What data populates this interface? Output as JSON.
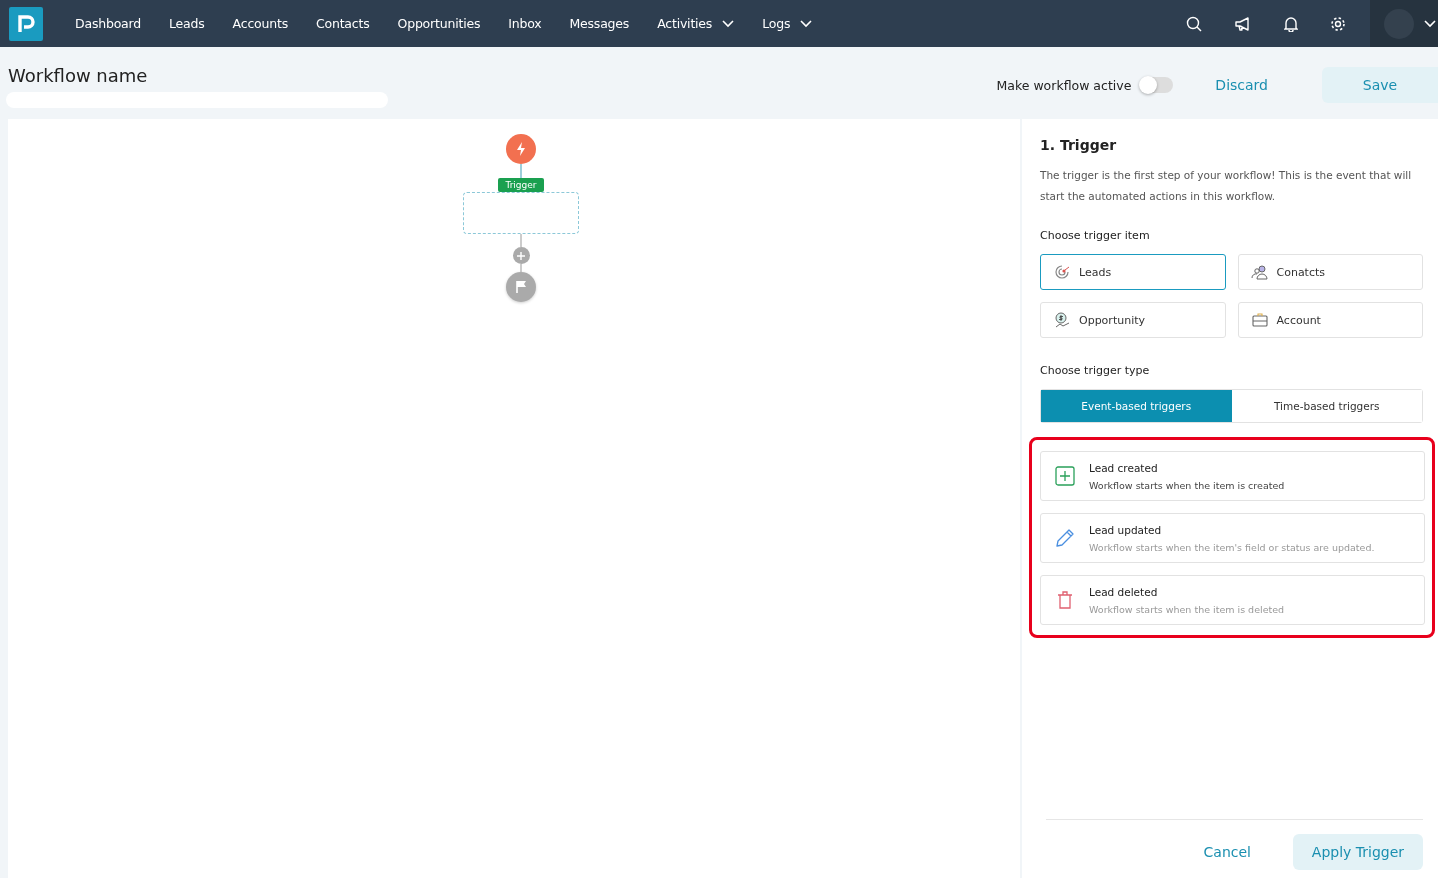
{
  "nav": {
    "items": [
      {
        "label": "Dashboard",
        "has_menu": false
      },
      {
        "label": "Leads",
        "has_menu": false
      },
      {
        "label": "Accounts",
        "has_menu": false
      },
      {
        "label": "Contacts",
        "has_menu": false
      },
      {
        "label": "Opportunities",
        "has_menu": false
      },
      {
        "label": "Inbox",
        "has_menu": false
      },
      {
        "label": "Messages",
        "has_menu": false
      },
      {
        "label": "Activities",
        "has_menu": true
      },
      {
        "label": "Logs",
        "has_menu": true
      }
    ]
  },
  "header": {
    "title": "Workflow name",
    "toggle": {
      "label": "Make workflow active",
      "on": false
    },
    "discard": "Discard",
    "save": "Save"
  },
  "canvas": {
    "trigger_label": "Trigger"
  },
  "panel": {
    "title": "1. Trigger",
    "description": "The trigger is the first step of your workflow! This is the event that will start the automated actions in this workflow.",
    "item_heading": "Choose trigger item",
    "items": [
      {
        "kind": "leads",
        "label": "Leads",
        "selected": true
      },
      {
        "kind": "contacts",
        "label": "Conatcts",
        "selected": false
      },
      {
        "kind": "opportunity",
        "label": "Opportunity",
        "selected": false
      },
      {
        "kind": "account",
        "label": "Account",
        "selected": false
      }
    ],
    "type_heading": "Choose trigger type",
    "types": [
      {
        "label": "Event-based triggers",
        "selected": true
      },
      {
        "label": "Time-based triggers",
        "selected": false
      }
    ],
    "events": [
      {
        "kind": "created",
        "title": "Lead created",
        "description": "Workflow starts when the item is created"
      },
      {
        "kind": "updated",
        "title": "Lead updated",
        "description": "Workflow starts when the item's field or status are updated."
      },
      {
        "kind": "deleted",
        "title": "Lead deleted",
        "description": "Workflow starts when the item is deleted"
      }
    ],
    "cancel": "Cancel",
    "apply": "Apply Trigger"
  }
}
